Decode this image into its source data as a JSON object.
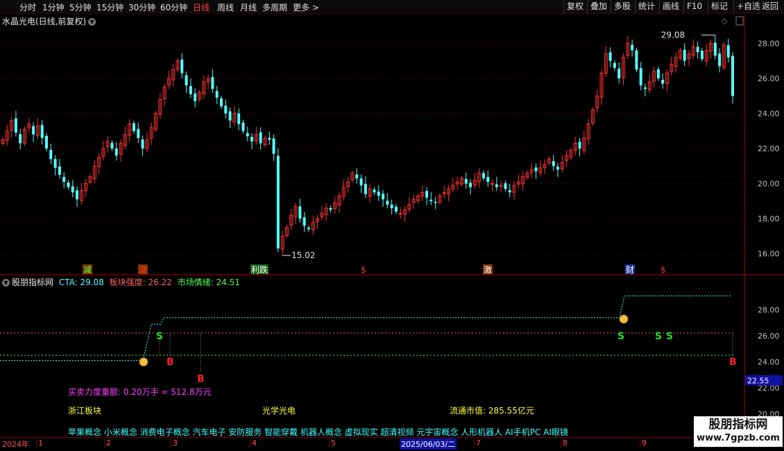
{
  "toolbar": {
    "periods": [
      "分时",
      "1分钟",
      "5分钟",
      "15分钟",
      "30分钟",
      "60分钟",
      "日线",
      "周线",
      "月线",
      "多周期",
      "更多 >"
    ],
    "active_period": "日线",
    "buttons": [
      "复权",
      "叠加",
      "多股",
      "统计",
      "画线",
      "F10",
      "标记",
      "+自选",
      "返回"
    ]
  },
  "stock": {
    "title": "水晶光电(日线,前复权)"
  },
  "indicator": {
    "name": "股朋指标网",
    "cta_label": "CTA: 29.08",
    "sector_label": "板块强度: 26.22",
    "mood_label": "市场情绪: 24.51"
  },
  "info": {
    "strength": "买卖力度重额: 0.20万手 = 512.8万元",
    "region": "浙江板块",
    "industry": "光学光电",
    "float_cap": "流通市值: 285.55亿元",
    "concepts": "苹果概念 小米概念 消费电子概念 汽车电子 安防服务 智能穿戴 机器人概念 虚拟现实 超清视频 元宇宙概念 人形机器人 AI手机PC AI眼镜"
  },
  "watermark": {
    "title": "股朋指标网",
    "url": "www.7gpzb.com"
  },
  "timeline": {
    "year": "2024年",
    "months": [
      "1",
      "2",
      "3",
      "4",
      "5",
      "6",
      "7",
      "8",
      "9"
    ],
    "cursor_date": "2025/06/03/二"
  },
  "colors": {
    "up": "#ff3232",
    "down": "#54ffff",
    "bg": "#000000",
    "grid": "#7a0000"
  },
  "chart_data": [
    {
      "type": "candlestick",
      "title": "水晶光电(日线,前复权)",
      "ylim": [
        14.8,
        29.6
      ],
      "yticks": [
        "16.00",
        "18.00",
        "20.00",
        "22.00",
        "24.00",
        "26.00",
        "28.00"
      ],
      "annotations": {
        "high": "29.08",
        "low": "15.02"
      },
      "event_markers": [
        "减",
        "涨",
        "利跌",
        "$",
        "激",
        "财",
        "$"
      ],
      "closes": [
        22.5,
        23.0,
        23.6,
        22.9,
        22.3,
        23.1,
        23.4,
        22.8,
        23.3,
        22.6,
        22.0,
        21.4,
        20.9,
        20.5,
        20.1,
        19.8,
        19.5,
        19.1,
        19.6,
        20.0,
        20.4,
        21.0,
        21.5,
        22.0,
        22.4,
        22.0,
        21.6,
        22.3,
        22.8,
        23.4,
        23.0,
        22.6,
        22.0,
        22.5,
        23.2,
        24.0,
        24.8,
        25.5,
        26.0,
        26.5,
        27.0,
        26.3,
        25.6,
        25.1,
        24.7,
        25.2,
        25.8,
        26.0,
        25.4,
        24.9,
        24.4,
        24.0,
        23.6,
        24.0,
        23.4,
        23.0,
        22.7,
        22.4,
        22.8,
        22.3,
        22.6,
        22.5,
        21.7,
        16.3,
        17.0,
        17.5,
        18.2,
        18.7,
        18.0,
        17.6,
        17.4,
        17.8,
        18.0,
        18.3,
        18.6,
        18.5,
        18.9,
        19.3,
        19.8,
        20.1,
        20.6,
        20.3,
        19.9,
        19.4,
        19.7,
        19.5,
        19.3,
        19.1,
        18.8,
        18.6,
        18.4,
        18.3,
        18.5,
        18.8,
        19.1,
        19.3,
        19.5,
        19.2,
        19.0,
        18.9,
        19.3,
        19.5,
        19.7,
        19.9,
        20.1,
        20.3,
        20.0,
        19.8,
        20.2,
        20.6,
        20.3,
        20.1,
        20.0,
        19.8,
        19.9,
        19.7,
        19.5,
        19.9,
        20.1,
        20.4,
        20.6,
        20.8,
        20.7,
        20.9,
        21.1,
        21.4,
        21.0,
        20.8,
        21.2,
        21.6,
        21.9,
        22.3,
        22.0,
        22.6,
        23.4,
        24.2,
        25.0,
        26.3,
        27.4,
        27.0,
        26.6,
        26.0,
        27.2,
        28.0,
        27.6,
        26.5,
        25.6,
        25.4,
        25.8,
        26.4,
        26.0,
        25.7,
        26.3,
        26.8,
        27.2,
        27.6,
        27.0,
        27.4,
        27.8,
        27.5,
        27.1,
        27.6,
        28.0,
        27.3,
        26.7,
        27.9,
        27.2,
        25.0
      ]
    },
    {
      "type": "line",
      "name": "股朋指标网",
      "ylim": [
        18.2,
        30.6
      ],
      "yticks": [
        "20.00",
        "22.00",
        "24.00",
        "26.00",
        "28.00"
      ],
      "current_value_tag": "22.55",
      "series": [
        {
          "name": "CTA",
          "value": 29.08
        },
        {
          "name": "板块强度",
          "value": 26.22
        },
        {
          "name": "市场情绪",
          "value": 24.51
        }
      ],
      "signals": [
        "B",
        "B",
        "S",
        "S",
        "S",
        "S",
        "B"
      ]
    }
  ]
}
